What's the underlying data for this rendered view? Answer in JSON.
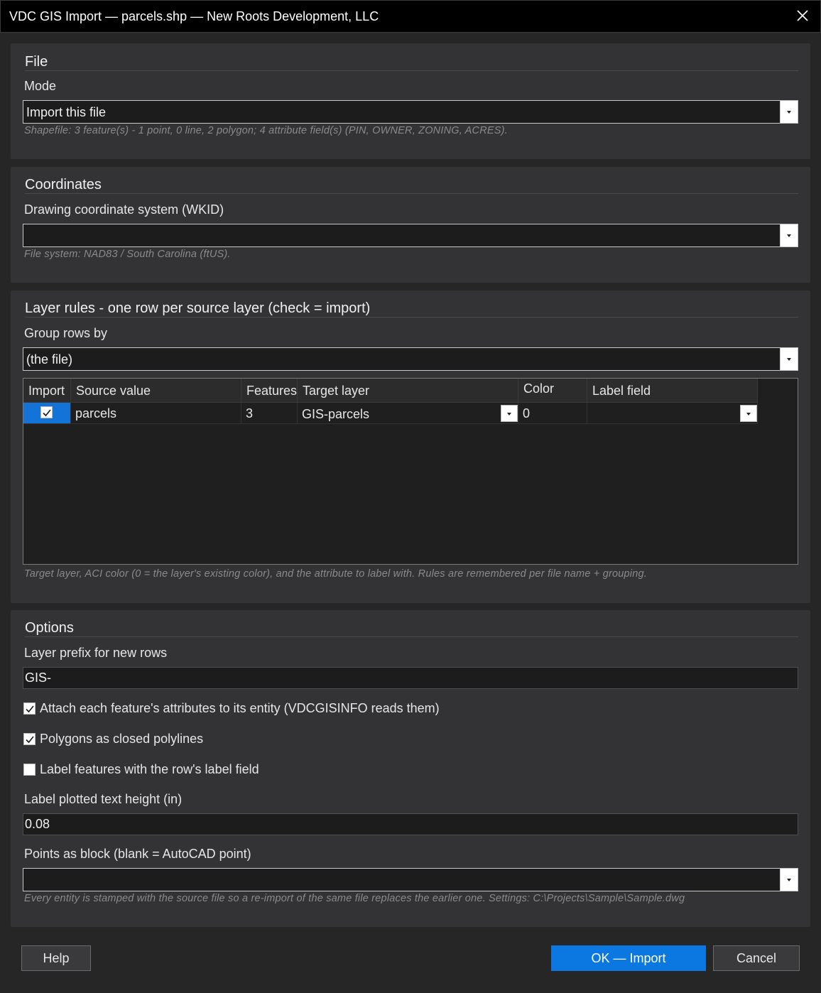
{
  "window": {
    "title": "VDC GIS Import — parcels.shp — New Roots Development, LLC"
  },
  "file_section": {
    "title": "File",
    "mode_label": "Mode",
    "mode_value": "Import this file",
    "hint": "Shapefile: 3 feature(s) - 1 point, 0 line, 2 polygon; 4 attribute field(s) (PIN, OWNER, ZONING, ACRES)."
  },
  "coordinates_section": {
    "title": "Coordinates",
    "wkid_label": "Drawing coordinate system (WKID)",
    "wkid_value": "",
    "hint": "File system: NAD83 / South Carolina (ftUS)."
  },
  "layer_rules_section": {
    "title": "Layer rules - one row per source layer (check = import)",
    "group_label": "Group rows by",
    "group_value": "(the file)",
    "columns": {
      "import": "Import",
      "source": "Source value",
      "features": "Features",
      "target": "Target layer",
      "color": "Color",
      "label": "Label field"
    },
    "rows": [
      {
        "import": true,
        "source": "parcels",
        "features": "3",
        "target": "GIS-parcels",
        "color": "0",
        "label": ""
      }
    ],
    "hint": "Target layer, ACI color (0 = the layer's existing color), and the attribute to label with. Rules are remembered per file name + grouping."
  },
  "options_section": {
    "title": "Options",
    "prefix_label": "Layer prefix for new rows",
    "prefix_value": "GIS-",
    "attach_label": "Attach each feature's attributes to its entity (VDCGISINFO reads them)",
    "attach_checked": true,
    "closed_label": "Polygons as closed polylines",
    "closed_checked": true,
    "labelfeat_label": "Label features with the row's label field",
    "labelfeat_checked": false,
    "height_label": "Label plotted text height (in)",
    "height_value": "0.08",
    "block_label": "Points as block (blank = AutoCAD point)",
    "block_value": "",
    "hint": "Every entity is stamped with the source file so a re-import of the same file replaces the earlier one. Settings: C:\\Projects\\Sample\\Sample.dwg"
  },
  "buttons": {
    "help": "Help",
    "ok": "OK — Import",
    "cancel": "Cancel"
  },
  "colors": {
    "accent": "#0a78e0",
    "selection": "#1473d6",
    "panel": "#333336",
    "background": "#262626"
  }
}
